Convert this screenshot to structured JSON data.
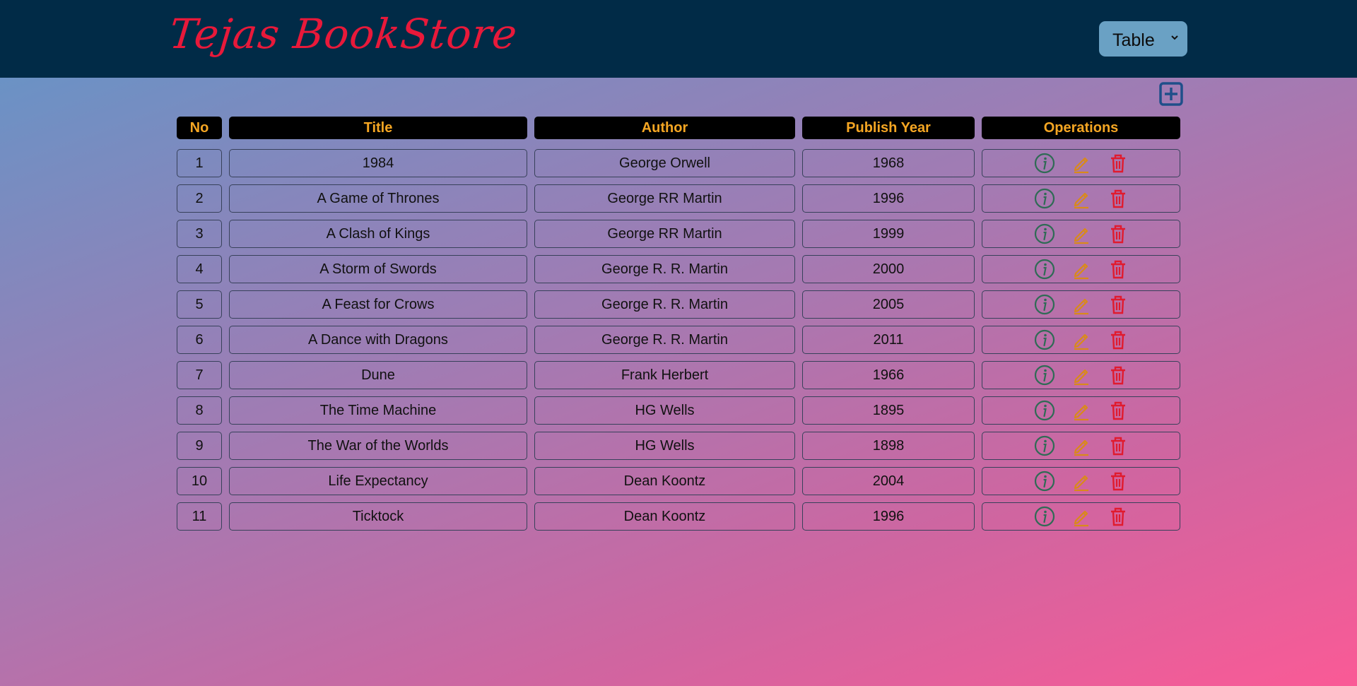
{
  "header": {
    "brand": "Tejas BookStore",
    "view_select": {
      "selected": "Table"
    }
  },
  "toolbar": {
    "add_icon": "plus-square-icon"
  },
  "table": {
    "columns": [
      "No",
      "Title",
      "Author",
      "Publish Year",
      "Operations"
    ],
    "rows": [
      {
        "no": "1",
        "title": "1984",
        "author": "George Orwell",
        "year": "1968"
      },
      {
        "no": "2",
        "title": "A Game of Thrones",
        "author": "George RR Martin",
        "year": "1996"
      },
      {
        "no": "3",
        "title": "A Clash of Kings",
        "author": "George RR Martin",
        "year": "1999"
      },
      {
        "no": "4",
        "title": "A Storm of Swords",
        "author": "George R. R. Martin",
        "year": "2000"
      },
      {
        "no": "5",
        "title": "A Feast for Crows",
        "author": "George R. R. Martin",
        "year": "2005"
      },
      {
        "no": "6",
        "title": "A Dance with Dragons",
        "author": "George R. R. Martin",
        "year": "2011"
      },
      {
        "no": "7",
        "title": "Dune",
        "author": "Frank Herbert",
        "year": "1966"
      },
      {
        "no": "8",
        "title": "The Time Machine",
        "author": "HG Wells",
        "year": "1895"
      },
      {
        "no": "9",
        "title": "The War of the Worlds",
        "author": "HG Wells",
        "year": "1898"
      },
      {
        "no": "10",
        "title": "Life Expectancy",
        "author": "Dean Koontz",
        "year": "2004"
      },
      {
        "no": "11",
        "title": "Ticktock",
        "author": "Dean Koontz",
        "year": "1996"
      }
    ],
    "operation_icons": [
      "info-circle-icon",
      "edit-pencil-icon",
      "delete-trash-icon"
    ]
  },
  "colors": {
    "navbar": "#012b47",
    "brand": "#e8193a",
    "header_text": "#f5a623",
    "info_icon": "#2f6b55",
    "edit_icon": "#d98a1a",
    "delete_icon": "#e01b2e",
    "add_icon": "#1f4f8a"
  }
}
